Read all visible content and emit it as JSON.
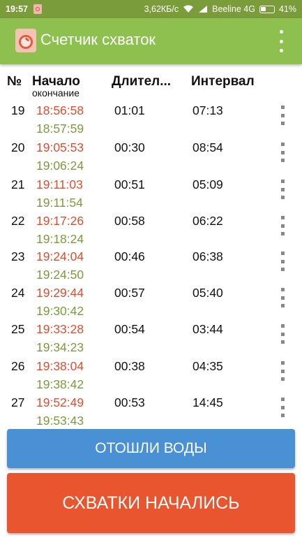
{
  "status_bar": {
    "time": "19:57",
    "network_speed": "3,62КБ/с",
    "carrier": "Beeline 4G",
    "battery": "41%"
  },
  "toolbar": {
    "title": "Счетчик схваток"
  },
  "header": {
    "num": "№",
    "start": "Начало",
    "end": "окончание",
    "duration": "Длител...",
    "interval": "Интервал"
  },
  "rows": [
    {
      "num": "19",
      "start": "18:56:58",
      "end": "18:57:59",
      "duration": "01:01",
      "interval": "07:13"
    },
    {
      "num": "20",
      "start": "19:05:53",
      "end": "19:06:24",
      "duration": "00:30",
      "interval": "08:54"
    },
    {
      "num": "21",
      "start": "19:11:03",
      "end": "19:11:54",
      "duration": "00:51",
      "interval": "05:09"
    },
    {
      "num": "22",
      "start": "19:17:26",
      "end": "19:18:24",
      "duration": "00:58",
      "interval": "06:22"
    },
    {
      "num": "23",
      "start": "19:24:04",
      "end": "19:24:50",
      "duration": "00:46",
      "interval": "06:38"
    },
    {
      "num": "24",
      "start": "19:29:44",
      "end": "19:30:42",
      "duration": "00:57",
      "interval": "05:40"
    },
    {
      "num": "25",
      "start": "19:33:28",
      "end": "19:34:23",
      "duration": "00:54",
      "interval": "03:44"
    },
    {
      "num": "26",
      "start": "19:38:04",
      "end": "19:38:42",
      "duration": "00:38",
      "interval": "04:35"
    },
    {
      "num": "27",
      "start": "19:52:49",
      "end": "19:53:43",
      "duration": "00:53",
      "interval": "14:45"
    }
  ],
  "buttons": {
    "water": "ОТОШЛИ ВОДЫ",
    "start": "СХВАТКИ НАЧАЛИСЬ"
  },
  "colors": {
    "start_time": "#e54b2c",
    "end_time": "#7a9c3b",
    "toolbar": "#8dc04e",
    "water_button": "#4a90d4",
    "start_button": "#e8552f"
  }
}
